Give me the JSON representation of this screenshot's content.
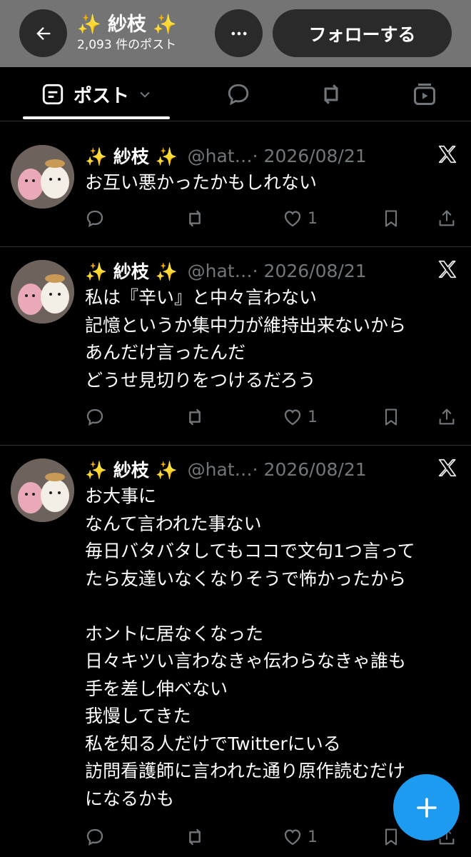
{
  "header": {
    "title": "✨ 紗枝 ✨",
    "post_count": "2,093 件のポスト",
    "follow_label": "フォローする",
    "icons": {
      "back": "arrow-left-icon",
      "more": "more-dots-icon"
    }
  },
  "tabs": {
    "posts_label": "ポスト",
    "icons": [
      "posts-icon",
      "chevron-down-icon",
      "replies-icon",
      "reposts-icon",
      "media-icon"
    ]
  },
  "posts": [
    {
      "name": "✨ 紗枝 ✨",
      "handle": "@hat…",
      "date": "· 2026/08/21",
      "text": "お互い悪かったかもしれない",
      "likes": "1"
    },
    {
      "name": "✨ 紗枝 ✨",
      "handle": "@hat…",
      "date": "· 2026/08/21",
      "text": "私は『辛い』と中々言わない\n記憶というか集中力が維持出来ないから\nあんだけ言ったんだ\nどうせ見切りをつけるだろう",
      "likes": "1"
    },
    {
      "name": "✨ 紗枝 ✨",
      "handle": "@hat…",
      "date": "· 2026/08/21",
      "text": "お大事に\nなんて言われた事ない\n毎日バタバタしてもココで文句1つ言って\nたら友達いなくなりそうで怖かったから\n\nホントに居なくなった\n日々キツい言わなきゃ伝わらなきゃ誰も\n手を差し伸べない\n我慢してきた\n私を知る人だけでTwitterにいる\n訪問看護師に言われた通り原作読むだけ\nになるかも",
      "likes": "1"
    }
  ],
  "colors": {
    "header_bg": "#747474",
    "background": "#000000",
    "muted_text": "#71767b",
    "accent": "#1d9bf0"
  },
  "fab": {
    "icon": "plus-icon"
  }
}
